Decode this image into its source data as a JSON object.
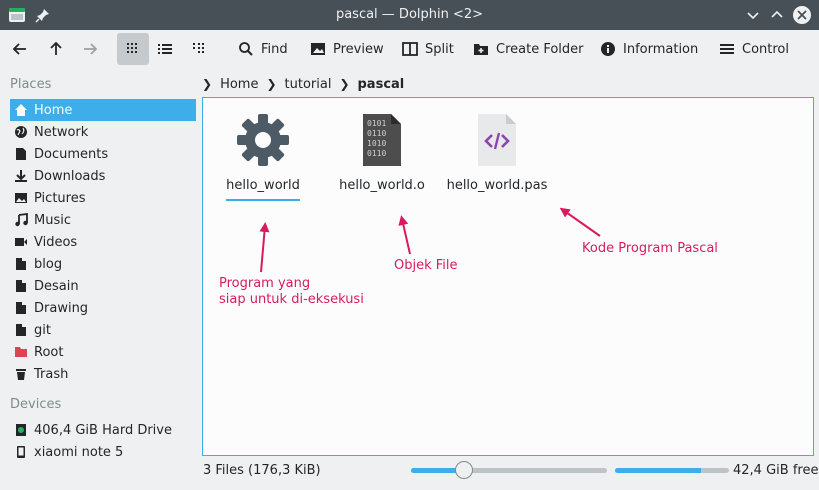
{
  "window": {
    "title": "pascal — Dolphin <2>"
  },
  "toolbar": {
    "back_icon": "arrow-left-icon",
    "up_icon": "arrow-up-icon",
    "forward_icon": "arrow-right-icon",
    "view_modes": [
      "icons-view",
      "compact-view",
      "details-view"
    ],
    "find_label": "Find",
    "preview_label": "Preview",
    "split_label": "Split",
    "create_folder_label": "Create Folder",
    "information_label": "Information",
    "control_label": "Control"
  },
  "sidebar": {
    "places_title": "Places",
    "places": [
      {
        "label": "Home",
        "icon": "home-icon"
      },
      {
        "label": "Network",
        "icon": "network-icon"
      },
      {
        "label": "Documents",
        "icon": "document-icon"
      },
      {
        "label": "Downloads",
        "icon": "download-icon"
      },
      {
        "label": "Pictures",
        "icon": "picture-icon"
      },
      {
        "label": "Music",
        "icon": "music-icon"
      },
      {
        "label": "Videos",
        "icon": "video-icon"
      },
      {
        "label": "blog",
        "icon": "folder-icon"
      },
      {
        "label": "Desain",
        "icon": "folder-icon"
      },
      {
        "label": "Drawing",
        "icon": "folder-icon"
      },
      {
        "label": "git",
        "icon": "folder-icon"
      },
      {
        "label": "Root",
        "icon": "folder-red-icon"
      },
      {
        "label": "Trash",
        "icon": "trash-icon"
      }
    ],
    "devices_title": "Devices",
    "devices": [
      {
        "label": "406,4 GiB Hard Drive",
        "icon": "hard-drive-icon"
      },
      {
        "label": "xiaomi note 5",
        "icon": "phone-icon"
      }
    ]
  },
  "breadcrumb": {
    "items": [
      "Home",
      "tutorial",
      "pascal"
    ]
  },
  "files": [
    {
      "name": "hello_world",
      "icon": "executable-gear-icon"
    },
    {
      "name": "hello_world.o",
      "icon": "binary-file-icon"
    },
    {
      "name": "hello_world.pas",
      "icon": "source-code-icon"
    }
  ],
  "annotations": {
    "executable": "Program yang\nsiap untuk di-eksekusi",
    "object": "Objek File",
    "source": "Kode Program Pascal"
  },
  "colors": {
    "accent": "#3daee9",
    "annotation": "#d81b60",
    "titlebar": "#475057"
  },
  "status": {
    "file_count": "3 Files (176,3 KiB)",
    "zoom_fraction": 0.27,
    "disk_used_fraction": 0.75,
    "free_space": "42,4 GiB free"
  }
}
